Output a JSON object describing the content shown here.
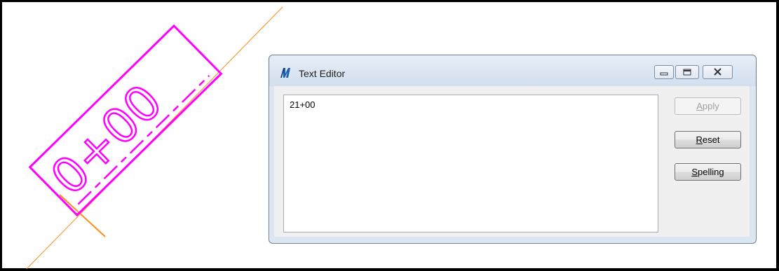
{
  "dialog": {
    "title": "Text Editor",
    "editor_text": "21+00",
    "buttons": {
      "apply_mnemonic": "A",
      "apply_rest": "pply",
      "reset_mnemonic": "R",
      "reset_rest": "eset",
      "spelling_mnemonic": "S",
      "spelling_rest": "pelling"
    },
    "window_controls": [
      "minimize-icon",
      "maximize-icon",
      "close-icon"
    ]
  },
  "canvas": {
    "station_label": "0+00",
    "label_color": "#ff00ff",
    "alignment_line_color": "#ff8c1a"
  },
  "colors": {
    "dialog_title_bg": "#dbe6f2",
    "client_bg": "#f0f0f0"
  }
}
